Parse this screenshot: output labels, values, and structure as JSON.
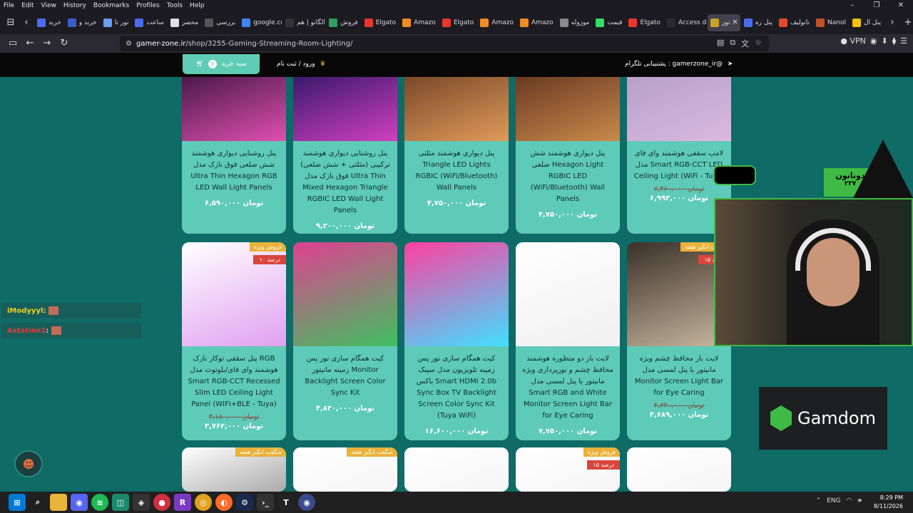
{
  "menubar": {
    "items": [
      "File",
      "Edit",
      "View",
      "History",
      "Bookmarks",
      "Profiles",
      "Tools",
      "Help"
    ]
  },
  "tabs": [
    {
      "label": "خرید",
      "color": "#4a6cf0"
    },
    {
      "label": "خرید و",
      "color": "#3a5ec8"
    },
    {
      "label": "نور تا",
      "color": "#6a9cf0"
    },
    {
      "label": "ساعت",
      "color": "#4a6cf0"
    },
    {
      "label": "محصر",
      "color": "#e0e0e0"
    },
    {
      "label": "بررسی",
      "color": "#555"
    },
    {
      "label": "google.co",
      "color": "#4285f4"
    },
    {
      "label": "الگانو | هم",
      "color": "#333"
    },
    {
      "label": "فروش",
      "color": "#2e9e5b"
    },
    {
      "label": "Elgato",
      "color": "#e8362e"
    },
    {
      "label": "Amazo",
      "color": "#f28b24"
    },
    {
      "label": "Elgato",
      "color": "#e8362e"
    },
    {
      "label": "Amazo",
      "color": "#f28b24"
    },
    {
      "label": "Amazo",
      "color": "#f28b24"
    },
    {
      "label": "موزوله",
      "color": "#888"
    },
    {
      "label": "قیمت",
      "color": "#3d6"
    },
    {
      "label": "Elgato",
      "color": "#e8362e"
    },
    {
      "label": "Access de",
      "color": "#2b2a33"
    },
    {
      "label": "نور",
      "color": "#c9a22a",
      "active": true
    },
    {
      "label": "پنل ره",
      "color": "#4a6cf0"
    },
    {
      "label": "نانولیف",
      "color": "#e04a2a"
    },
    {
      "label": "Nanol",
      "color": "#c0502a"
    },
    {
      "label": "پنل ال",
      "color": "#f0c20a"
    }
  ],
  "navbar": {
    "url_domain": "gamer-zone.ir",
    "url_path": "/shop/3255-Gaming-Streaming-Room-Lighting/",
    "vpn_label": "VPN"
  },
  "site_header": {
    "cart_label": "سبد خرید",
    "cart_count": "0",
    "login_label": "ورود / ثبت نام",
    "telegram_label": "پشتیبانی تلگرام : gamerzone_ir@"
  },
  "products": [
    {
      "title": "لامپ سقفی هوشمند وای فای مدل Smart RGB-CCT LED Ceiling Light (WiFi - Tuya)",
      "old": "۷,۳۶۰,۰۰۰ تومان",
      "price": "۶,۹۹۲,۰۰۰ تومان",
      "badge": "",
      "disc": "",
      "c1": "#b7a0c8",
      "c2": "#d9b9e0"
    },
    {
      "title": "پنل دیواری هوشمند شش ضلعی Hexagon Light RGBIC LED (WiFi/Bluetooth) Wall Panels",
      "old": "",
      "price": "۴,۷۵۰,۰۰۰ تومان",
      "badge": "",
      "disc": "",
      "c1": "#6a3a24",
      "c2": "#c98a4a"
    },
    {
      "title": "پنل دیواری هوشمند مثلثی Triangle LED Lights RGBIC (WiFi/Bluetooth) Wall Panels",
      "old": "",
      "price": "۴,۷۵۰,۰۰۰ تومان",
      "badge": "",
      "disc": "",
      "c1": "#7a4a2a",
      "c2": "#e09a5a"
    },
    {
      "title": "پنل روشنایی دیواری هوشمند ترکیبی (مثلثی + شش ضلعی) فوق نازک مدل Ultra Thin Mixed Hexagon Triangle RGBIC LED Wall Light Panels",
      "old": "",
      "price": "۹,۲۰۰,۰۰۰ تومان",
      "badge": "",
      "disc": "",
      "c1": "#3a1a6a",
      "c2": "#d040c0"
    },
    {
      "title": "پنل روشنایی دیواری هوشمند شش ضلعی فوق نازک مدل Ultra Thin Hexagon RGB LED Wall Light Panels",
      "old": "",
      "price": "۶,۵۹۰,۰۰۰ تومان",
      "badge": "",
      "disc": "",
      "c1": "#4a1a4a",
      "c2": "#e050b0"
    },
    {
      "title": "لایت بار محافظ چشم ویژه مانیتور با پنل لمسی مدل Monitor Screen Light Bar for Eye Caring",
      "old": "۴,۳۴۰,۰۰۰ تومان",
      "price": "۳,۶۸۹,۰۰۰ تومان",
      "badge": "شگفت انگیز هفته",
      "disc": "۱۵ درصد",
      "c1": "#3a3028",
      "c2": "#c8b8a0"
    },
    {
      "title": "لایت بار دو منظوره هوشمند محافظ چشم و نورپردازی ویژه مانیتور با پنل لمسی مدل Smart RGB and White Monitor Screen Light Bar for Eye Caring",
      "old": "",
      "price": "۷,۷۵۰,۰۰۰ تومان",
      "badge": "",
      "disc": "",
      "c1": "#ffffff",
      "c2": "#f0f0f0"
    },
    {
      "title": "کیت همگام سازی نور پس زمینه تلویزیون مدل سینک باکس Smart HDMI 2.0b Sync Box TV Backlight Screen Color Sync Kit (Tuya WiFi)",
      "old": "",
      "price": "۱۶,۶۰۰,۰۰۰ تومان",
      "badge": "",
      "disc": "",
      "c1": "#ff40a0",
      "c2": "#40e0ff"
    },
    {
      "title": "کیت همگام سازی نور پس زمینه مانیتور Monitor Backlight Screen Color Sync Kit",
      "old": "",
      "price": "۴,۸۲۰,۰۰۰ تومان",
      "badge": "",
      "disc": "",
      "c1": "#e04090",
      "c2": "#40c060"
    },
    {
      "title": "پنل سقفی توکار نازک RGB هوشمند وای فای/بلوتوث مدل Smart RGB-CCT Recessed Slim LED Ceiling Light Panel (WIFI+BLE - Tuya)",
      "old": "۴,۱۸۰,۰۰۰ تومان",
      "price": "۳,۷۶۲,۰۰۰ تومان",
      "badge": "فروش ویژه",
      "disc": "۱۰ درصد",
      "c1": "#ffffff",
      "c2": "#e0a0f0"
    },
    {
      "title": "",
      "old": "",
      "price": "",
      "badge": "",
      "disc": "",
      "c1": "#ffffff",
      "c2": "#f5f5f5"
    },
    {
      "title": "",
      "old": "",
      "price": "",
      "badge": "فروش ویژه",
      "disc": "۱۵ درصد",
      "c1": "#ffffff",
      "c2": "#f5f5f5"
    },
    {
      "title": "",
      "old": "",
      "price": "",
      "badge": "",
      "disc": "",
      "c1": "#ffffff",
      "c2": "#f5f5f5"
    },
    {
      "title": "",
      "old": "",
      "price": "",
      "badge": "شگفت انگیز هفته",
      "disc": "",
      "c1": "#ffffff",
      "c2": "#f5f5f5"
    },
    {
      "title": "",
      "old": "",
      "price": "",
      "badge": "شگفت انگیز هفته",
      "disc": "",
      "c1": "#ffffff",
      "c2": "#aaaaaa"
    }
  ],
  "chat": [
    {
      "user": "iModyyyl",
      "color": "#f0d020"
    },
    {
      "user": "Astatine2",
      "color": "#e03a3a"
    }
  ],
  "overlay": {
    "donation_label": "دونانون",
    "donation_count": "۲۳۷",
    "gamdom_label": "Gamdom"
  },
  "taskbar": {
    "time": "8:29 PM",
    "date": "8/11/2026",
    "lang": "ENG"
  },
  "colors": {
    "page_bg": "#0e6b66",
    "card_bg": "#5ecab8",
    "accent_green": "#3fbb45"
  }
}
